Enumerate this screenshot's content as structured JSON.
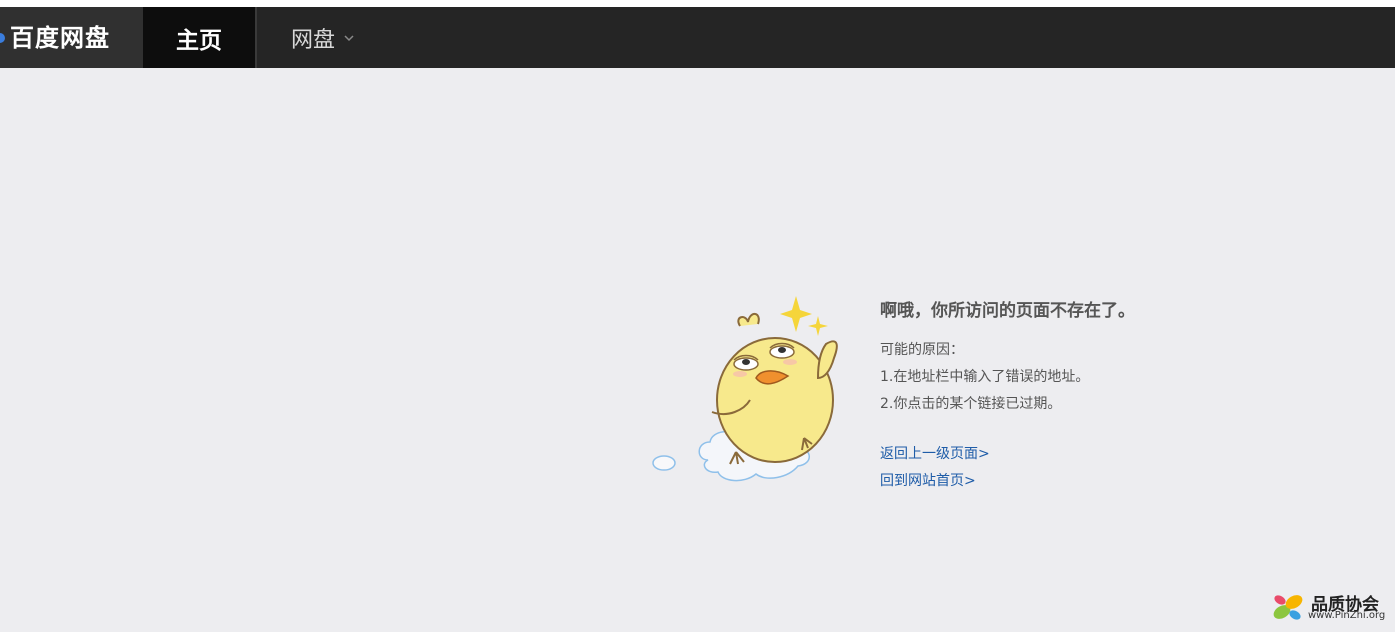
{
  "header": {
    "logo_text": "百度网盘",
    "nav": {
      "home_label": "主页",
      "pan_label": "网盘"
    }
  },
  "error": {
    "title": "啊哦，你所访问的页面不存在了。",
    "reasons_heading": "可能的原因：",
    "reasons": [
      "1.在地址栏中输入了错误的地址。",
      "2.你点击的某个链接已过期。"
    ],
    "links": [
      "返回上一级页面>",
      "回到网站首页>"
    ]
  },
  "watermark": {
    "name": "品质协会",
    "url": "www.PinZhi.org"
  },
  "colors": {
    "nav_bg": "#252525",
    "nav_active_bg": "#0d0d0d",
    "page_bg": "#ededf0",
    "link": "#1e5ca8",
    "chick_yellow": "#f7e98c"
  }
}
